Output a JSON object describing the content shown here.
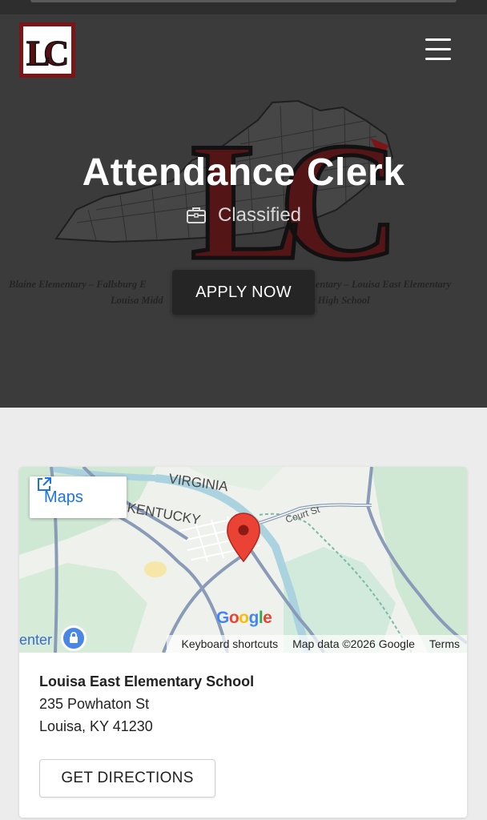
{
  "header": {
    "logo_text": "LC",
    "menu_icon": "hamburger-menu-icon"
  },
  "hero": {
    "title": "Attendance Clerk",
    "category_icon": "briefcase-icon",
    "category": "Classified",
    "background_letters": "LC",
    "schools_line_1": "Blaine Elementary – Fallsburg E",
    "schools_line_1b": "mentary – Louisa East Elementary",
    "schools_line_2": "Louisa Midd",
    "schools_line_2b": "y High School",
    "apply_label": "APPLY NOW"
  },
  "map": {
    "maps_link_label": "Maps",
    "maps_link_icon": "external-link-icon",
    "labels": {
      "state_1": "VIRGINIA",
      "state_2": "KENTUCKY",
      "street": "Court St",
      "poi_partial": "enter"
    },
    "google_logo": "Google",
    "footer": {
      "shortcuts": "Keyboard shortcuts",
      "map_data": "Map data ©2026 Google",
      "terms": "Terms"
    },
    "marker_icon": "map-pin-icon",
    "poi_icon": "shopping-bag-icon"
  },
  "location": {
    "name": "Louisa East Elementary School",
    "street": "235 Powhaton St",
    "city_state_zip": "Louisa, KY 41230",
    "directions_label": "GET DIRECTIONS"
  },
  "colors": {
    "hero_background": "#3b3b3b",
    "brand_maroon": "#7a1518",
    "link_blue": "#1a73e8",
    "pin_red": "#ea4335"
  }
}
